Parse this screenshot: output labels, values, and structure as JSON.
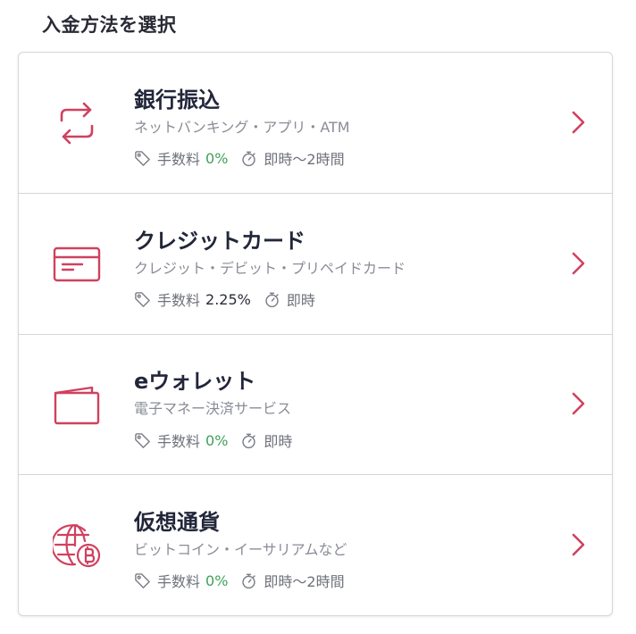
{
  "section_title": "入金方法を選択",
  "colors": {
    "accent": "#d0415f",
    "fee_zero": "#41a05a",
    "divider": "#d6d6da"
  },
  "fee_label": "手数料",
  "methods": [
    {
      "title": "銀行振込",
      "subtitle": "ネットバンキング・アプリ・ATM",
      "icon": "transfer-arrows-icon",
      "fee": "0%",
      "fee_color": "green",
      "time": "即時〜2時間"
    },
    {
      "title": "クレジットカード",
      "subtitle": "クレジット・デビット・プリペイドカード",
      "icon": "credit-card-icon",
      "fee": "2.25%",
      "fee_color": "dark",
      "time": "即時"
    },
    {
      "title": "eウォレット",
      "subtitle": "電子マネー決済サービス",
      "icon": "wallet-icon",
      "fee": "0%",
      "fee_color": "green",
      "time": "即時"
    },
    {
      "title": "仮想通貨",
      "subtitle": "ビットコイン・イーサリアムなど",
      "icon": "globe-bitcoin-icon",
      "fee": "0%",
      "fee_color": "green",
      "time": "即時〜2時間"
    }
  ]
}
